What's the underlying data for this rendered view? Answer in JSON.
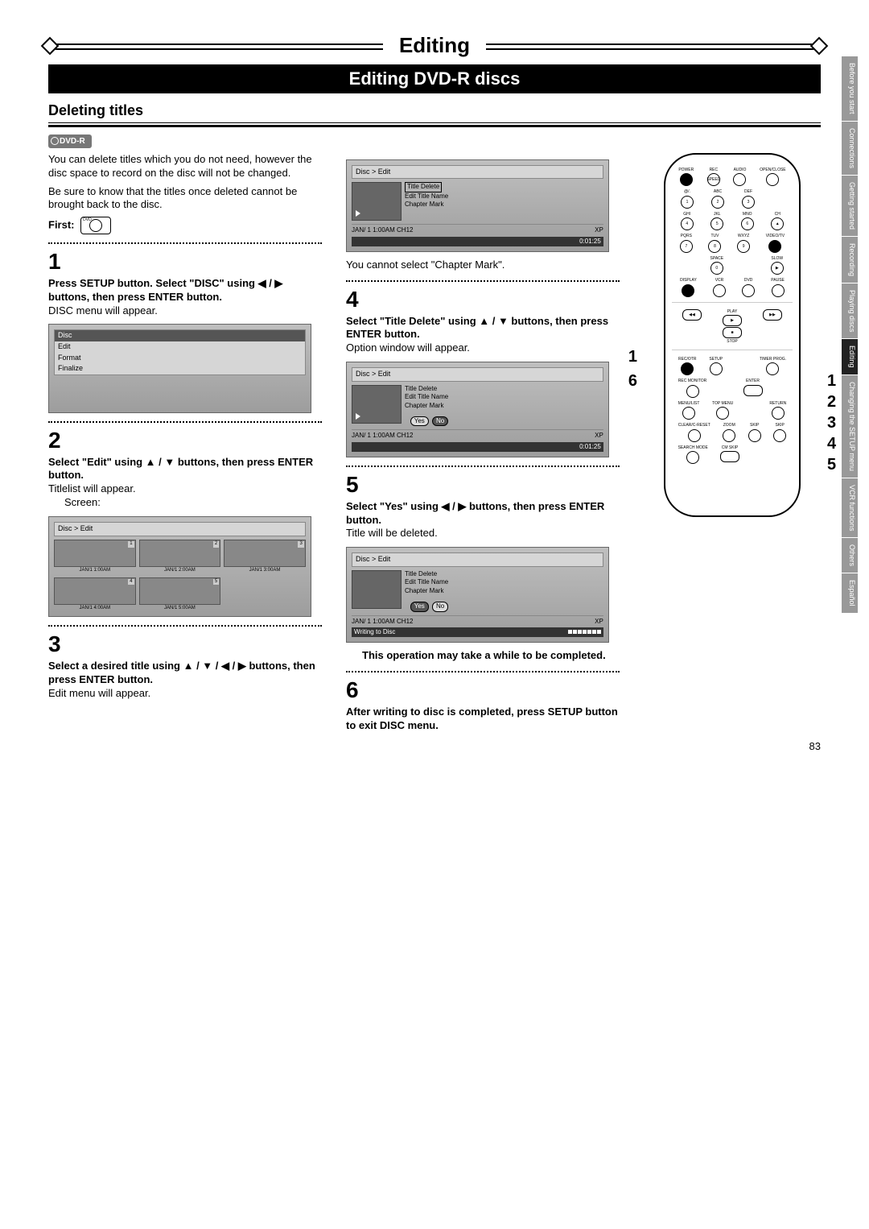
{
  "header": {
    "title": "Editing",
    "subtitle": "Editing DVD-R discs"
  },
  "section_heading": "Deleting titles",
  "dvdr_badge": "DVD-R",
  "intro": {
    "p1": "You can delete titles which you do not need, however the disc space to record on the disc will not be changed.",
    "p2": "Be sure to know that the titles once deleted cannot be brought back to the disc.",
    "first_label": "First:"
  },
  "steps": {
    "s1": {
      "num": "1",
      "bold": "Press SETUP button. Select \"DISC\" using ◀ / ▶ buttons, then press ENTER button.",
      "after": "DISC menu will appear."
    },
    "s2": {
      "num": "2",
      "bold": "Select \"Edit\" using ▲ / ▼ buttons, then press ENTER button.",
      "after": "Titlelist will appear.",
      "screen_label": "Screen:"
    },
    "s3": {
      "num": "3",
      "bold": "Select a desired title using ▲ / ▼ / ◀ / ▶ buttons, then press ENTER button.",
      "after": "Edit menu will appear."
    },
    "chapter_note": "You cannot select \"Chapter Mark\".",
    "s4": {
      "num": "4",
      "bold": "Select \"Title Delete\" using ▲ / ▼ buttons, then press ENTER button.",
      "after": "Option window will appear."
    },
    "s5": {
      "num": "5",
      "bold": "Select \"Yes\" using ◀ / ▶ buttons, then press ENTER button.",
      "after": "Title will be deleted."
    },
    "warning": "This operation may take a while to be completed.",
    "s6": {
      "num": "6",
      "bold": "After writing to disc is completed, press SETUP button to exit DISC menu."
    }
  },
  "screens": {
    "disc_menu": {
      "title": "Disc",
      "items": [
        "Edit",
        "Format",
        "Finalize"
      ]
    },
    "titlelist": {
      "breadcrumb": "Disc > Edit",
      "thumbs": [
        {
          "num": "1",
          "label": "JAN/1 1:00AM"
        },
        {
          "num": "2",
          "label": "JAN/1 2:00AM"
        },
        {
          "num": "3",
          "label": "JAN/1 3:00AM"
        },
        {
          "num": "4",
          "label": "JAN/1 4:00AM"
        },
        {
          "num": "5",
          "label": "JAN/1 5:00AM"
        }
      ]
    },
    "edit_menu": {
      "breadcrumb": "Disc > Edit",
      "options": [
        "Title Delete",
        "Edit Title Name",
        "Chapter Mark"
      ],
      "status_left": "JAN/ 1   1:00AM  CH12",
      "status_right": "XP",
      "timer": "0:01:25"
    },
    "confirm": {
      "yes": "Yes",
      "no": "No"
    },
    "writing": {
      "label": "Writing to Disc"
    }
  },
  "remote": {
    "rows": [
      [
        "POWER",
        "REC SPEED",
        "AUDIO",
        "OPEN/CLOSE"
      ],
      [
        "@/. 1",
        "ABC 2",
        "DEF 3",
        ""
      ],
      [
        "GHI 4",
        "JKL 5",
        "MNO 6",
        "CH ▲"
      ],
      [
        "PQRS 7",
        "TUV 8",
        "WXYZ 9",
        "VIDEO/TV"
      ],
      [
        "",
        "SPACE 0",
        "",
        "SLOW ▶"
      ],
      [
        "DISPLAY",
        "VCR",
        "DVD",
        "PAUSE"
      ]
    ],
    "nav": {
      "play": "PLAY",
      "stop": "STOP",
      "rew": "◀◀",
      "ff": "▶▶"
    },
    "lower": [
      [
        "REC/OTR",
        "SETUP",
        "",
        "TIMER PROG."
      ],
      [
        "REC MONITOR",
        "",
        "ENTER",
        ""
      ],
      [
        "MENU/LIST",
        "TOP MENU",
        "",
        "RETURN"
      ],
      [
        "CLEAR/C-RESET",
        "ZOOM",
        "SKIP",
        "SKIP"
      ],
      [
        "SEARCH MODE",
        "CM SKIP",
        "",
        ""
      ]
    ]
  },
  "callouts": {
    "left": [
      "1",
      "6"
    ],
    "right": [
      "1",
      "2",
      "3",
      "4",
      "5"
    ]
  },
  "tabs": [
    "Before you start",
    "Connections",
    "Getting started",
    "Recording",
    "Playing discs",
    "Editing",
    "Changing the SETUP menu",
    "VCR functions",
    "Others",
    "Español"
  ],
  "active_tab": "Editing",
  "page_number": "83"
}
